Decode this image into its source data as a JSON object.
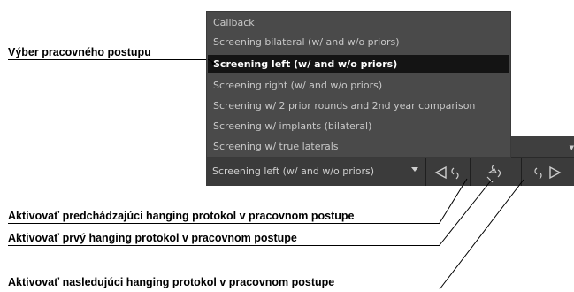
{
  "callouts": {
    "select_workflow": "Výber pracovného postupu",
    "prev_protocol": "Aktivovať predchádzajúci hanging protokol v pracovnom postupe",
    "first_protocol": "Aktivovať prvý hanging protokol v pracovnom postupe",
    "next_protocol": "Aktivovať nasledujúci hanging protokol v pracovnom postupe"
  },
  "workflow_menu": {
    "items": [
      "Callback",
      "Screening bilateral (w/ and w/o priors)",
      "Screening left (w/ and w/o priors)",
      "Screening right (w/ and w/o priors)",
      "Screening w/ 2 prior rounds and 2nd year comparison",
      "Screening w/ implants (bilateral)",
      "Screening w/ true laterals"
    ],
    "selected_index": 2
  },
  "toolbar": {
    "dropdown_value": "Screening left (w/ and w/o priors)"
  },
  "icons": {
    "dropdown": "chevron-down-icon",
    "prev": "previous-protocol-icon",
    "first": "first-protocol-icon",
    "next": "next-protocol-icon"
  },
  "colors": {
    "menu_bg": "#4a4a4a",
    "menu_selected_bg": "#141414",
    "toolbar_bg": "#3b3b3b",
    "text_light": "#c8c8c8"
  }
}
